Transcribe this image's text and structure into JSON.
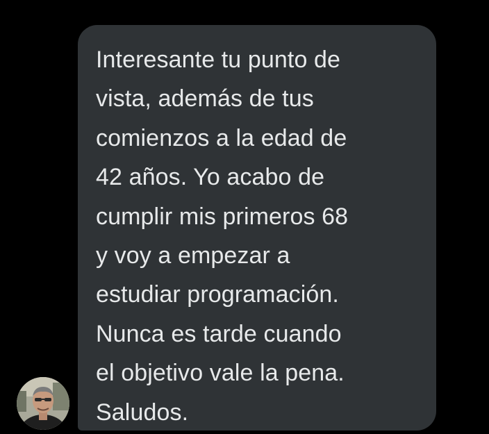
{
  "conversation": {
    "message": {
      "text": "Interesante tu punto de\nvista, además de tus\ncomienzos a la edad de\n42 años. Yo acabo de\ncumplir mis primeros 68\ny voy a empezar a\nestudiar programación.\nNunca es tarde cuando\nel objetivo vale la pena.\nSaludos."
    },
    "sender": {
      "avatar_icon": "user-photo-avatar"
    }
  },
  "colors": {
    "background": "#000000",
    "bubble": "#2f3336",
    "text": "#e7e9ea"
  }
}
